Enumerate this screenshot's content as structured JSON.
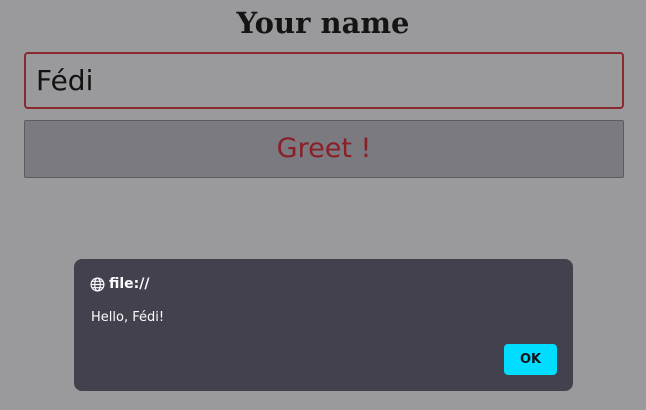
{
  "form": {
    "heading": "Your name",
    "name_value": "Fédi",
    "greet_label": "Greet !"
  },
  "dialog": {
    "origin": "file://",
    "origin_icon": "globe-icon",
    "message": "Hello, Fédi!",
    "ok_label": "OK"
  },
  "colors": {
    "page_background": "#9a999b",
    "input_border": "#8a2a2f",
    "button_text": "#8a1f27",
    "dialog_background": "#42414d",
    "ok_button": "#00ddff"
  }
}
